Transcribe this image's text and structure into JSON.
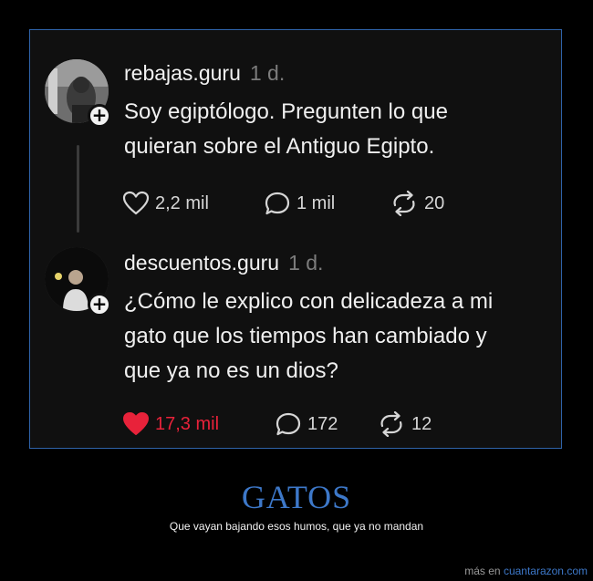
{
  "posts": [
    {
      "username": "rebajas.guru",
      "time": "1 d.",
      "text_lines": [
        "Soy egiptólogo. Pregunten lo que",
        "quieran sobre el Antiguo Egipto."
      ],
      "likes": "2,2 mil",
      "comments": "1 mil",
      "reposts": "20",
      "liked": false
    },
    {
      "username": "descuentos.guru",
      "time": "1 d.",
      "text_lines": [
        "¿Cómo le explico con delicadeza a mi",
        "gato que los tiempos han cambiado y",
        "que ya no es un dios?"
      ],
      "likes": "17,3 mil",
      "comments": "172",
      "reposts": "12",
      "liked": true
    }
  ],
  "caption": {
    "title": "GATOS",
    "subtitle": "Que vayan bajando esos humos, que ya no mandan"
  },
  "footer": {
    "prefix": "más en",
    "site": "cuantarazon.com"
  },
  "icons": {
    "follow": "plus-icon",
    "like": "heart-icon",
    "comment": "speech-bubble-icon",
    "repost": "repost-icon"
  },
  "colors": {
    "like_active": "#e8223a",
    "caption_blue": "#3d78c9",
    "frame_border": "#2f63a9"
  }
}
